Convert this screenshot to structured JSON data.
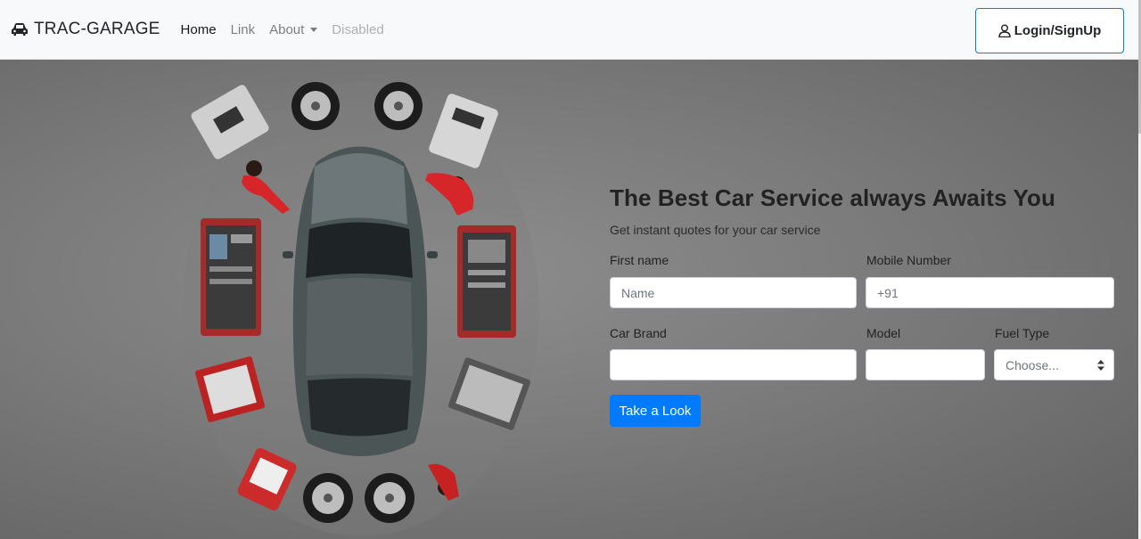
{
  "navbar": {
    "brand": "TRAC-GARAGE",
    "links": [
      {
        "label": "Home"
      },
      {
        "label": "Link"
      },
      {
        "label": "About"
      },
      {
        "label": "Disabled"
      }
    ],
    "login_label": "Login/SignUp"
  },
  "hero": {
    "title": "The Best Car Service always Awaits You",
    "subtitle": "Get instant quotes for your car service",
    "form": {
      "first_name_label": "First name",
      "first_name_placeholder": "Name",
      "mobile_label": "Mobile Number",
      "mobile_value": "+91",
      "car_brand_label": "Car Brand",
      "car_brand_value": "",
      "model_label": "Model",
      "model_value": "",
      "fuel_label": "Fuel Type",
      "fuel_selected": "Choose...",
      "submit_label": "Take a Look"
    }
  },
  "colors": {
    "primary": "#007bff",
    "navbar_bg": "#f8f9fa",
    "hero_bg": "#7b7b7b"
  },
  "icons": {
    "brand": "car-icon",
    "login": "user-icon",
    "about": "caret-down-icon",
    "fuel": "select-arrows-icon"
  }
}
